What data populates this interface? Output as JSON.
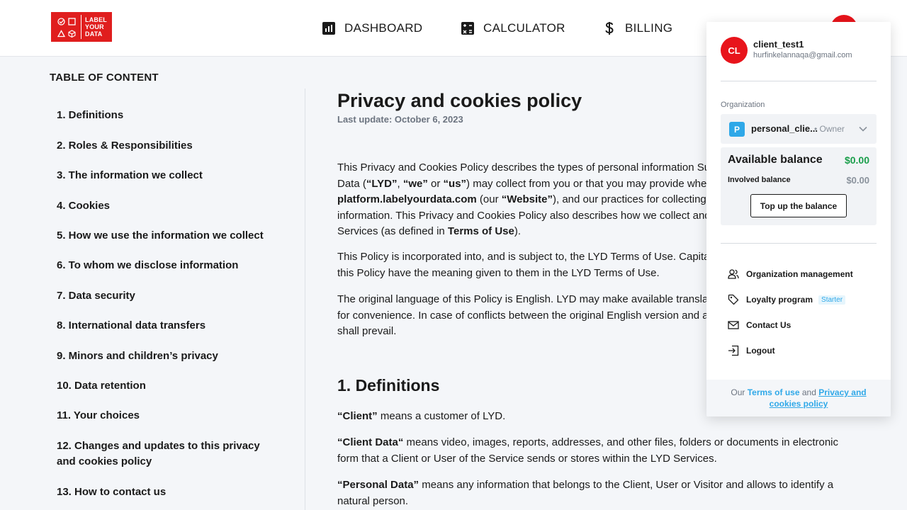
{
  "header": {
    "logo": {
      "text_lines": [
        "LABEL",
        "YOUR",
        "DATA"
      ]
    },
    "nav": [
      {
        "label": "DASHBOARD",
        "icon": "chart-icon"
      },
      {
        "label": "CALCULATOR",
        "icon": "calculator-icon"
      },
      {
        "label": "BILLING",
        "icon": "dollar-icon"
      }
    ]
  },
  "toc": {
    "title": "TABLE OF CONTENT",
    "items": [
      "1. Definitions",
      "2. Roles & Responsibilities",
      "3. The information we collect",
      "4. Cookies",
      "5. How we use the information we collect",
      "6. To whom we disclose information",
      "7. Data security",
      "8. International data transfers",
      "9. Minors and children’s privacy",
      "10. Data retention",
      "11. Your choices",
      "12. Changes and updates to this privacy and cookies policy",
      "13. How to contact us"
    ]
  },
  "content": {
    "title": "Privacy and cookies policy",
    "last_update": "Last update: October 6, 2023",
    "intro_1": {
      "t1": "This Privacy and Cookies Policy describes the types of personal information Suppo",
      "t2": "Data (",
      "b1": "“LYD”",
      "t3": ", ",
      "b2": "“we”",
      "t4": " or ",
      "b3": "“us”",
      "t5": ") may collect from you or that you may provide when you v",
      "b4": "platform.labelyourdata.com",
      "t6": " (our ",
      "b5": "“Website”",
      "t7": "), and our practices for collecting, using",
      "t8": "information. This Privacy and Cookies Policy also describes how we collect and use",
      "t9": "Services (as defined in ",
      "b6": "Terms of Use",
      "t10": ")."
    },
    "intro_2": {
      "l1": "This Policy is incorporated into, and is subject to, the LYD Terms of Use. Capitalized",
      "l2": "this Policy have the meaning given to them in the LYD Terms of Use."
    },
    "intro_3": {
      "l1": "The original language of this Policy is English. LYD may make available translations",
      "l2": "for convenience. In case of conflicts between the original English version and any t",
      "l3": "shall prevail."
    },
    "section_1_title": "1. Definitions",
    "defs": [
      {
        "term": "“Client”",
        "text": " means a customer of LYD."
      },
      {
        "term": "“Client Data“",
        "text": " means video, images, reports, addresses, and other files, folders or documents in electronic form that a Client or User of the Service sends or stores within the LYD Services."
      },
      {
        "term": "“Personal Data”",
        "text": " means any information that belongs to the Client, User or Visitor and allows to identify a natural person."
      }
    ]
  },
  "account_panel": {
    "avatar_initials": "CL",
    "username": "client_test1",
    "email": "hurfinkelannaqa@gmail.com",
    "organization_label": "Organization",
    "org_badge": "P",
    "org_name": "personal_clie...",
    "org_role": "• Owner",
    "available_balance_label": "Available balance",
    "available_balance_value": "$0.00",
    "involved_balance_label": "Involved balance",
    "involved_balance_value": "$0.00",
    "topup_label": "Top up the balance",
    "menu": [
      {
        "label": "Organization management",
        "icon": "users-icon"
      },
      {
        "label": "Loyalty program",
        "icon": "tag-icon",
        "badge": "Starter"
      },
      {
        "label": "Contact Us",
        "icon": "mail-icon"
      },
      {
        "label": "Logout",
        "icon": "logout-icon"
      }
    ],
    "footer": {
      "our": "Our ",
      "terms": "Terms of use",
      "and": " and ",
      "privacy": "Privacy and cookies policy"
    }
  },
  "colors": {
    "brand_red": "#e01e1e",
    "accent_blue": "#2fa8e8",
    "balance_green": "#1a9e4b"
  }
}
